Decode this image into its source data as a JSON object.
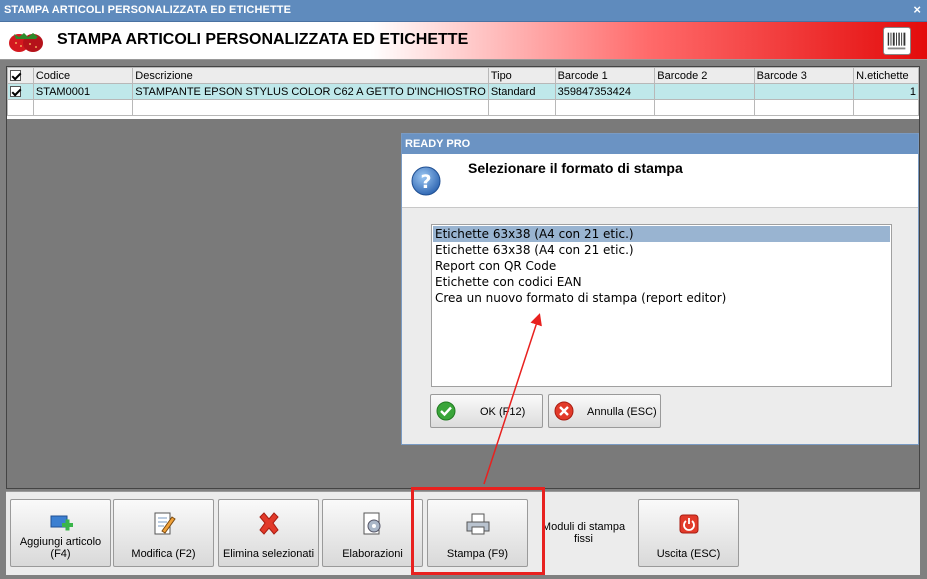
{
  "window": {
    "title": "STAMPA ARTICOLI PERSONALIZZATA ED ETICHETTE",
    "close": "×"
  },
  "header": {
    "title": "STAMPA ARTICOLI PERSONALIZZATA ED ETICHETTE"
  },
  "grid": {
    "columns": [
      "Codice",
      "Descrizione",
      "Tipo",
      "Barcode 1",
      "Barcode 2",
      "Barcode 3",
      "N.etichette"
    ],
    "rows": [
      {
        "checked": true,
        "codice": "STAM0001",
        "descrizione": "STAMPANTE EPSON STYLUS COLOR C62 A GETTO D'INCHIOSTRO",
        "tipo": "Standard",
        "barcode1": "359847353424",
        "barcode2": "",
        "barcode3": "",
        "netichette": "1"
      }
    ]
  },
  "dialog": {
    "title": "READY PRO",
    "prompt": "Selezionare il formato di stampa",
    "options": [
      "Etichette 63x38 (A4 con 21 etic.)",
      "Etichette 63x38 (A4 con 21 etic.)",
      "Report con QR Code",
      "Etichette con codici EAN",
      "Crea un nuovo formato di stampa (report editor)"
    ],
    "selected_index": 0,
    "ok_label": "OK (F12)",
    "cancel_label": "Annulla (ESC)"
  },
  "toolbar": {
    "add_label_1": "Aggiungi articolo",
    "add_label_2": "(F4)",
    "edit_label": "Modifica (F2)",
    "delete_label": "Elimina selezionati",
    "process_label": "Elaborazioni",
    "print_label": "Stampa (F9)",
    "fixed_label_1": "Moduli di stampa",
    "fixed_label_2": "fissi",
    "exit_label": "Uscita (ESC)"
  },
  "colors": {
    "highlight": "#e8211f",
    "selection": "#99b4d1",
    "row_selected": "#bfe8ea",
    "titlebar": "#5f8bbd"
  }
}
